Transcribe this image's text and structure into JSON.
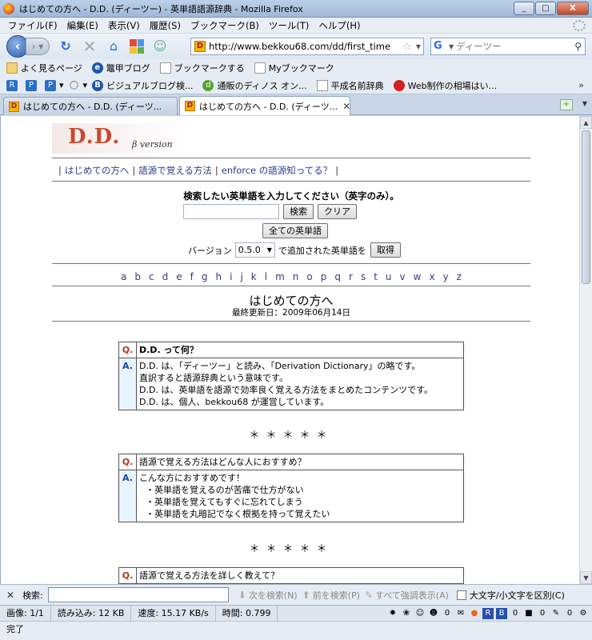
{
  "window": {
    "title": "はじめての方へ - D.D. (ディーツー) - 英単語語源辞典 - Mozilla Firefox",
    "buttons": [
      "_",
      "□",
      "X"
    ]
  },
  "menu": [
    "ファイル(F)",
    "編集(E)",
    "表示(V)",
    "履歴(S)",
    "ブックマーク(B)",
    "ツール(T)",
    "ヘルプ(H)"
  ],
  "nav": {
    "url": "http://www.bekkou68.com/dd/first_time",
    "search_placeholder": "ディーツー",
    "site_icon_letter": "D"
  },
  "bookmarks1": [
    "よく見るページ",
    "鼈甲ブログ",
    "ブックマークする",
    "Myブックマーク"
  ],
  "bookmarks2": [
    "ビジュアルブログ検...",
    "通販のディノス オン...",
    "平成名前辞典",
    "Web制作の相場はい..."
  ],
  "bookmarks2_more": "»",
  "tabs": [
    {
      "label": "はじめての方へ - D.D. (ディーツ...",
      "active": false
    },
    {
      "label": "はじめての方へ - D.D. (ディーツ...",
      "active": true
    }
  ],
  "page": {
    "logo": "D.D.",
    "logo_sub": "β version",
    "topnav": [
      "はじめての方へ",
      "語源で覚える方法",
      "enforce の語源知ってる？"
    ],
    "search_heading": "検索したい英単語を入力してください（英字のみ）。",
    "search_btn": "検索",
    "clear_btn": "クリア",
    "all_words_btn": "全ての英単語",
    "version_label": "バージョン",
    "version_value": "0.5.0",
    "version_suffix": "で追加された英単語を",
    "get_btn": "取得",
    "alphabet": [
      "a",
      "b",
      "c",
      "d",
      "e",
      "f",
      "g",
      "h",
      "i",
      "j",
      "k",
      "l",
      "m",
      "n",
      "o",
      "p",
      "q",
      "r",
      "s",
      "t",
      "u",
      "v",
      "w",
      "x",
      "y",
      "z"
    ],
    "title": "はじめての方へ",
    "updated": "最終更新日：2009年06月14日",
    "stars": "＊＊＊＊＊",
    "qa": [
      {
        "q_label": "Q.",
        "question": "D.D. って何？",
        "a_label": "A.",
        "answer_lines": [
          "D.D. は、「ディーツー」と読み、「Derivation Dictionary」の略です。",
          "直訳すると語源辞典という意味です。",
          "D.D. は、英単語を語源で効率良く覚える方法をまとめたコンテンツです。",
          "D.D. は、個人、bekkou68 が運営しています。"
        ]
      },
      {
        "q_label": "Q.",
        "question": "語源で覚える方法はどんな人におすすめ？",
        "a_label": "A.",
        "answer_lines": [
          "こんな方におすすめです！",
          "・英単語を覚えるのが苦痛で仕方がない",
          "・英単語を覚えてもすぐに忘れてしまう",
          "・英単語を丸暗記でなく根拠を持って覚えたい"
        ]
      },
      {
        "q_label": "Q.",
        "question": "語源で覚える方法を詳しく教えて？"
      }
    ]
  },
  "findbar": {
    "label": "検索:",
    "next": "次を検索(N)",
    "prev": "前を検索(P)",
    "highlight": "すべて強調表示(A)",
    "match_case": "大文字/小文字を区別(C)"
  },
  "status": {
    "images": "画像: 1/1",
    "loaded": "読み込み: 12 KB",
    "speed": "速度: 15.17 KB/s",
    "time": "時間: 0.799",
    "count_a": "0",
    "count_b": "0",
    "count_c": "0",
    "count_d": "0",
    "done": "完了"
  }
}
